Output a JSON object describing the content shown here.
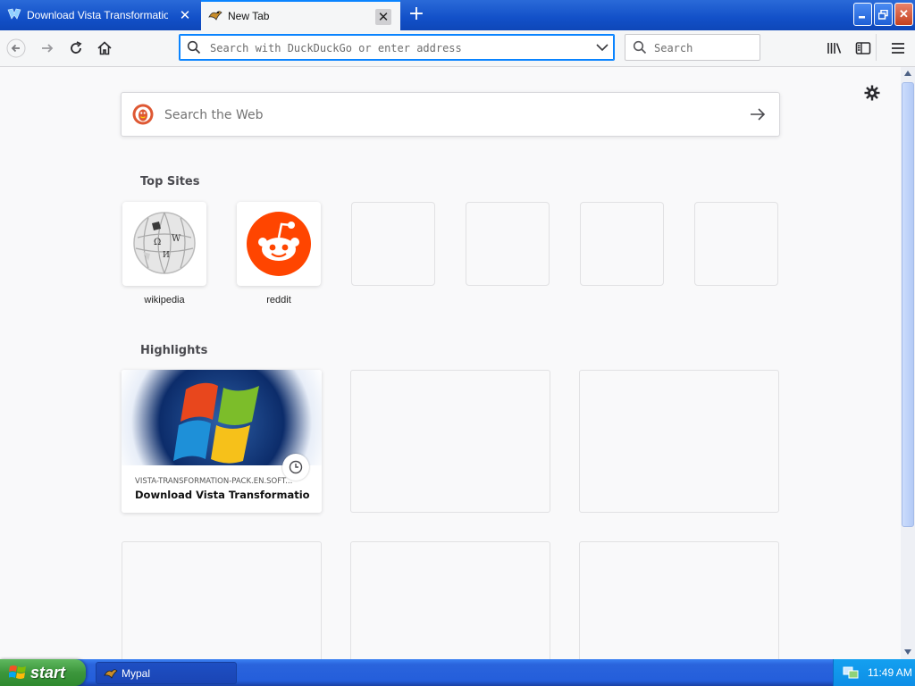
{
  "browser": {
    "tabs": [
      {
        "title": "Download Vista Transformation Pa",
        "active": false
      },
      {
        "title": "New Tab",
        "active": true
      }
    ],
    "address_placeholder": "Search with DuckDuckGo or enter address",
    "search_placeholder": "Search"
  },
  "newtab": {
    "websearch_placeholder": "Search the Web",
    "top_sites_title": "Top Sites",
    "top_sites": [
      {
        "label": "wikipedia",
        "icon": "wikipedia-globe-icon"
      },
      {
        "label": "reddit",
        "icon": "reddit-alien-icon"
      },
      {
        "label": ""
      },
      {
        "label": ""
      },
      {
        "label": ""
      },
      {
        "label": ""
      }
    ],
    "highlights_title": "Highlights",
    "highlights": [
      {
        "url": "VISTA-TRANSFORMATION-PACK.EN.SOFT...",
        "title": "Download Vista Transformation ...",
        "icon": "windows-logo-icon"
      }
    ]
  },
  "taskbar": {
    "start_label": "start",
    "tasks": [
      {
        "label": "Mypal"
      }
    ],
    "clock": "11:49 AM"
  },
  "colors": {
    "accent": "#0a84ff",
    "titlebar": "#1250c8",
    "taskbar": "#245edb",
    "reddit": "#ff4500"
  }
}
